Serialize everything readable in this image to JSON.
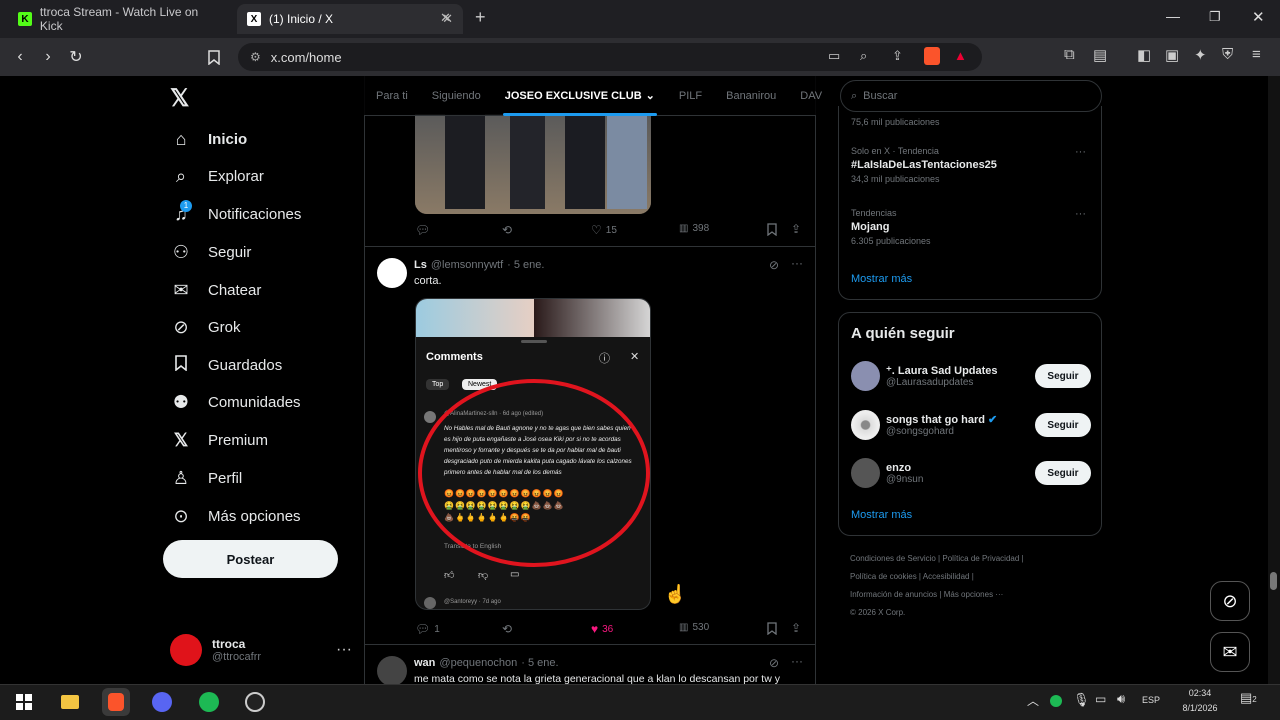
{
  "browser": {
    "tabs": [
      {
        "title": "ttroca Stream - Watch Live on Kick"
      },
      {
        "title": "(1) Inicio / X"
      }
    ],
    "url": "x.com/home"
  },
  "nav": {
    "items": [
      {
        "label": "Inicio",
        "icon": "home-icon"
      },
      {
        "label": "Explorar",
        "icon": "search-icon"
      },
      {
        "label": "Notificaciones",
        "icon": "bell-icon",
        "badge": "1"
      },
      {
        "label": "Seguir",
        "icon": "person-add-icon"
      },
      {
        "label": "Chatear",
        "icon": "mail-icon"
      },
      {
        "label": "Grok",
        "icon": "grok-icon"
      },
      {
        "label": "Guardados",
        "icon": "bookmark-icon"
      },
      {
        "label": "Comunidades",
        "icon": "communities-icon"
      },
      {
        "label": "Premium",
        "icon": "x-icon"
      },
      {
        "label": "Perfil",
        "icon": "profile-icon"
      },
      {
        "label": "Más opciones",
        "icon": "more-circle-icon"
      }
    ],
    "post_label": "Postear",
    "account": {
      "name": "ttroca",
      "handle": "@ttrocafrr",
      "more": "···"
    }
  },
  "feed": {
    "tabs": [
      "Para ti",
      "Siguiendo",
      "JOSEO EXCLUSIVE CLUB",
      "PILF",
      "Bananirou",
      "DAV"
    ],
    "post1": {
      "likes": "15",
      "views": "398"
    },
    "post2": {
      "name": "Ls",
      "handle": "@lemsonnywtf",
      "date": "· 5 ene.",
      "text": "corta.",
      "replies": "1",
      "likes": "36",
      "views": "530",
      "embed": {
        "title": "Comments",
        "tab_top": "Top",
        "tab_newest": "Newest",
        "commenter": "@AlinaMartinez-slln · 6d ago (edited)",
        "comment": "No Hables mal de Bauti agnone y no te agas que bien sabes quien es hijo de puta engañaste a José osea Kiki por si no te acordas mentiroso y forrante y después se te da por hablar mal de bauti desgraciado puto de mierda kakita puta cagado lávate los calzones primero antes de hablar mal de los demás",
        "translate": "Translate to English",
        "next_commenter": "@Santoreyy · 7d ago"
      }
    },
    "post3": {
      "name": "wan",
      "handle": "@pequenochon",
      "date": "· 5 ene.",
      "text": "me mata como se nota la grieta generacional que a klan lo descansan por tw y"
    }
  },
  "right": {
    "search_placeholder": "Buscar",
    "trends": [
      {
        "meta": "",
        "name": "",
        "count": "75,6 mil publicaciones"
      },
      {
        "meta": "Solo en X · Tendencia",
        "name": "#LaIslaDeLasTentaciones25",
        "count": "34,3 mil publicaciones"
      },
      {
        "meta": "Tendencias",
        "name": "Mojang",
        "count": "6.305 publicaciones"
      }
    ],
    "show_more": "Mostrar más",
    "who_title": "A quién seguir",
    "who": [
      {
        "name": "  ⁺. Laura Sad Updates",
        "handle": "@Laurasadupdates",
        "button": "Seguir",
        "color": "#8a8fb0"
      },
      {
        "name": "songs that go hard",
        "handle": "@songsgohard",
        "button": "Seguir",
        "color": "#d8d8d8",
        "verified": true
      },
      {
        "name": "enzo",
        "handle": "@9nsun",
        "button": "Seguir",
        "color": "#555"
      }
    ],
    "who_more": "Mostrar más",
    "footer": [
      "Condiciones de Servicio",
      "Política de Privacidad",
      "Política de cookies",
      "Accesibilidad",
      "Información de anuncios",
      "Más opciones ···",
      "© 2026 X Corp."
    ]
  },
  "taskbar": {
    "lang": "ESP",
    "time": "02:34",
    "date": "8/1/2026",
    "notif_count": "2"
  },
  "colors": {
    "accent": "#1d9bf0",
    "like": "#f91880",
    "red_circle": "#e0141e"
  }
}
